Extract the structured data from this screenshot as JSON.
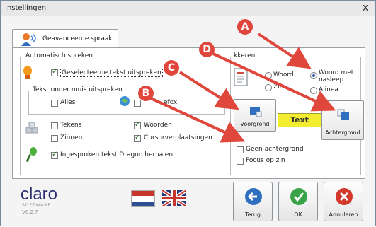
{
  "window": {
    "title": "Instellingen",
    "close_glyph": "x"
  },
  "tab": {
    "label": "Geavanceerde spraak"
  },
  "auto_speak": {
    "title": "Automatisch spreken",
    "selected_text": "Geselecteerde tekst uitspreken",
    "under_mouse_title": "Tekst onder muis uitspreken",
    "all": "Alles",
    "firefox_partial": "efox",
    "chars": "Tekens",
    "words": "Woorden",
    "sentences": "Zinnen",
    "cursor_moves": "Cursorverplaatsingen",
    "dragon": "Ingesproken tekst Dragon herhalen"
  },
  "mark": {
    "title": "Markeren",
    "title_partial_visible": "kkeren",
    "word": "Woord",
    "sentence": "Zin",
    "word_after": "Woord met nasleep",
    "paragraph": "Alinea",
    "sample_text": "Text",
    "foreground": "Voorgrond",
    "background": "Achtergrond",
    "no_background": "Geen achtergrond",
    "focus_sentence": "Focus op zin"
  },
  "annotations": [
    "A",
    "B",
    "C",
    "D"
  ],
  "footer": {
    "brand": "claro",
    "brand_sub": "SOFTWARE",
    "version": "V6.2.7",
    "back": "Terug",
    "ok": "OK",
    "cancel": "Annuleren"
  },
  "colors": {
    "accent_red": "#e0473c",
    "highlight_yellow": "#f2ee2f",
    "ok_green": "#3aa34a",
    "back_blue": "#2f6fbf",
    "cancel_red": "#d2382c"
  }
}
